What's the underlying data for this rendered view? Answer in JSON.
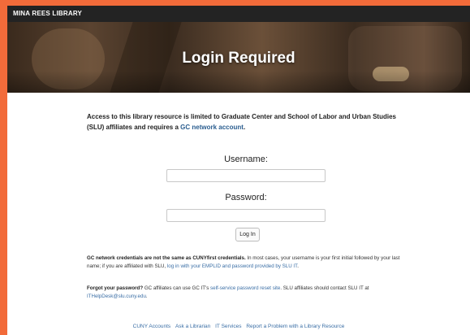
{
  "brand": "MINA REES LIBRARY",
  "hero": {
    "title": "Login Required"
  },
  "intro": {
    "text": "Access to this library resource is limited to Graduate Center and School of Labor and Urban Studies (SLU) affiliates and requires a ",
    "link": "GC network account",
    "end": "."
  },
  "form": {
    "username_label": "Username:",
    "password_label": "Password:",
    "username_value": "",
    "password_value": "",
    "login_button": "Log In"
  },
  "credentials_note": {
    "bold": "GC network credentials are not the same as CUNYfirst credentials.",
    "text": " In most cases, your username is your first initial followed by your last name; if you are affiliated with SLU, ",
    "link": "log in with your EMPLID and password provided by SLU IT",
    "end": "."
  },
  "forgot_note": {
    "bold": "Forgot your password?",
    "text1": " GC affiliates can use GC IT's ",
    "link1": "self-service password reset site",
    "text2": ". SLU affiliates should contact SLU IT at ",
    "link2": "ITHelpDesk@slu.cuny.edu",
    "end": "."
  },
  "footer": {
    "links": [
      "CUNY Accounts",
      "Ask a Librarian",
      "IT Services",
      "Report a Problem with a Library Resource"
    ]
  },
  "colors": {
    "background": "#f26b3a",
    "link": "#2a5d8f",
    "topbar": "#232323"
  }
}
